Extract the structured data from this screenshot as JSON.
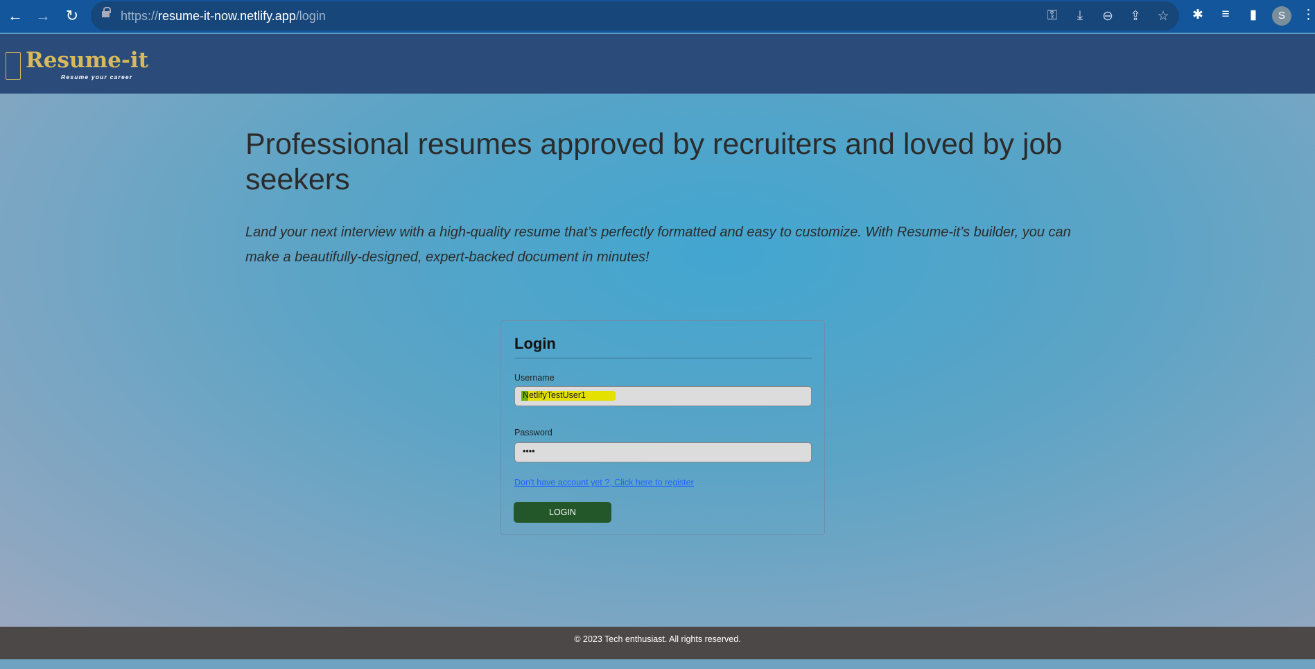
{
  "browser": {
    "url_scheme": "https://",
    "url_host": "resume-it-now.netlify.app",
    "url_path": "/login",
    "profile_initial": "S",
    "toolbar_icons": [
      "key-icon",
      "install-icon",
      "zoom-out-icon",
      "share-icon",
      "star-icon",
      "extensions-icon",
      "media-icon",
      "side-panel-icon"
    ]
  },
  "header": {
    "logo": "Resume-it",
    "tagline": "Resume your career"
  },
  "hero": {
    "title": "Professional resumes approved by recruiters and loved by job seekers",
    "subtitle": "Land your next interview with a high-quality resume that’s perfectly formatted and easy to customize. With Resume-it’s builder, you can make a beautifully-designed, expert-backed document in minutes!"
  },
  "login": {
    "title": "Login",
    "username_label": "Username",
    "username_value": "NetlifyTestUser1",
    "password_label": "Password",
    "password_value": "••••",
    "register_link": "Don't have account yet ?, Click here to register",
    "submit": "LOGIN"
  },
  "footer": {
    "text": "© 2023 Tech enthusiast. All rights reserved."
  },
  "colors": {
    "header": "#2b4c7a",
    "logo": "#d8b95c",
    "button": "#235628",
    "footer": "#4d4848"
  }
}
